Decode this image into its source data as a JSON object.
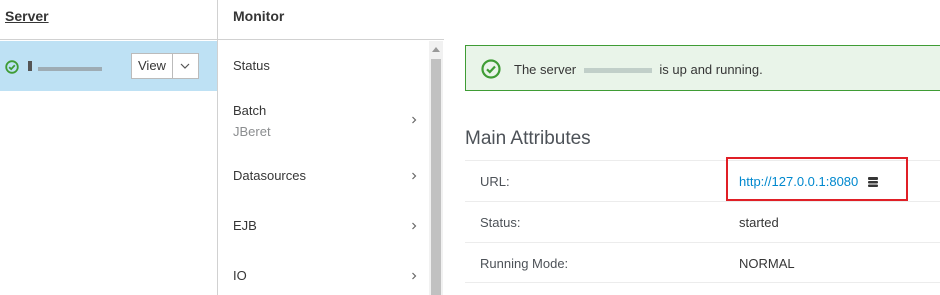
{
  "server_column": {
    "header": "Server",
    "server": {
      "name": "",
      "view_label": "View"
    }
  },
  "monitor_column": {
    "header": "Monitor",
    "items": [
      {
        "label": "Status",
        "sublabel": ""
      },
      {
        "label": "Batch",
        "sublabel": "JBeret"
      },
      {
        "label": "Datasources",
        "sublabel": ""
      },
      {
        "label": "EJB",
        "sublabel": ""
      },
      {
        "label": "IO",
        "sublabel": ""
      }
    ]
  },
  "detail": {
    "title": "",
    "alert": {
      "prefix": "The server",
      "suffix": "is up and running."
    },
    "section_title": "Main Attributes",
    "attributes": [
      {
        "key": "URL:",
        "value": "http://127.0.0.1:8080"
      },
      {
        "key": "Status:",
        "value": "started"
      },
      {
        "key": "Running Mode:",
        "value": "NORMAL"
      }
    ]
  },
  "colors": {
    "selected_row": "#bee1f4",
    "success": "#3f9c35",
    "link": "#0088ce",
    "highlight": "#e01f26"
  },
  "icons": [
    "check-circle-icon",
    "chevron-down-icon",
    "chevron-right-icon",
    "scroll-up-icon",
    "database-icon"
  ]
}
